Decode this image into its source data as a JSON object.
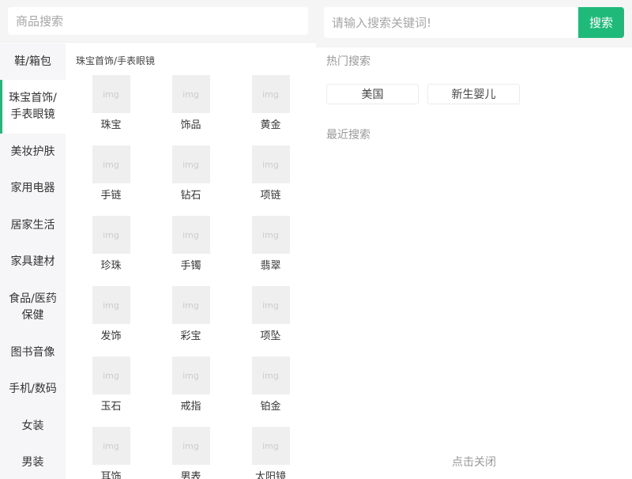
{
  "left": {
    "search": {
      "placeholder": "商品搜索",
      "value": ""
    },
    "sidebar": {
      "active_index": 1,
      "items": [
        {
          "label": "鞋/箱包"
        },
        {
          "label": "珠宝首饰/手表眼镜"
        },
        {
          "label": "美妆护肤"
        },
        {
          "label": "家用电器"
        },
        {
          "label": "居家生活"
        },
        {
          "label": "家具建材"
        },
        {
          "label": "食品/医药保健"
        },
        {
          "label": "图书音像"
        },
        {
          "label": "手机/数码"
        },
        {
          "label": "女装"
        },
        {
          "label": "男装"
        }
      ]
    },
    "content": {
      "title": "珠宝首饰/手表眼镜",
      "image_placeholder": "img",
      "items": [
        {
          "label": "珠宝"
        },
        {
          "label": "饰品"
        },
        {
          "label": "黄金"
        },
        {
          "label": "手链"
        },
        {
          "label": "钻石"
        },
        {
          "label": "项链"
        },
        {
          "label": "珍珠"
        },
        {
          "label": "手镯"
        },
        {
          "label": "翡翠"
        },
        {
          "label": "发饰"
        },
        {
          "label": "彩宝"
        },
        {
          "label": "项坠"
        },
        {
          "label": "玉石"
        },
        {
          "label": "戒指"
        },
        {
          "label": "铂金"
        },
        {
          "label": "耳饰"
        },
        {
          "label": "男表"
        },
        {
          "label": "太阳镜"
        }
      ]
    }
  },
  "right": {
    "search": {
      "placeholder": "请输入搜索关键词!",
      "value": "",
      "button_label": "搜索"
    },
    "hot_search": {
      "title": "热门搜索",
      "tags": [
        {
          "label": "美国"
        },
        {
          "label": "新生婴儿"
        }
      ]
    },
    "recent_search": {
      "title": "最近搜索",
      "items": []
    },
    "close_label": "点击关闭"
  },
  "colors": {
    "accent": "#1fba7a",
    "header_bg": "#f5f5f6",
    "sidebar_bg": "#f6f6f8",
    "thumb_bg": "#efefef"
  }
}
